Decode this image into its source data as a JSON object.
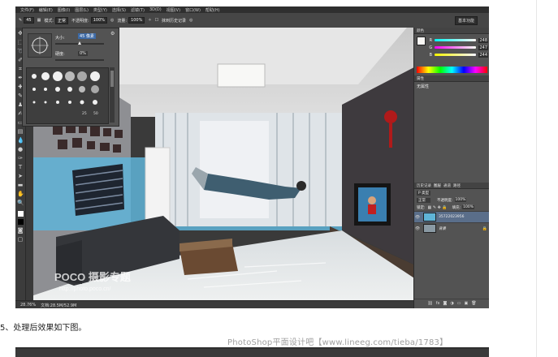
{
  "menubar": {
    "items": [
      "文件(F)",
      "编辑(E)",
      "图像(I)",
      "图层(L)",
      "类型(Y)",
      "选择(S)",
      "滤镜(T)",
      "3D(D)",
      "视图(V)",
      "窗口(W)",
      "帮助(H)"
    ]
  },
  "options_bar": {
    "brush_size": "45",
    "mode_label": "模式:",
    "mode_value": "正常",
    "opacity_label": "不透明度:",
    "opacity_value": "100%",
    "flow_label": "流量:",
    "flow_value": "100%",
    "history_label": "抹到历史记录",
    "workspace": "基本功能"
  },
  "brush_panel": {
    "size_label": "大小:",
    "size_value": "45 像素",
    "hardness_label": "硬度:",
    "hardness_value": "0%",
    "preset_numbers": [
      "25",
      "50"
    ]
  },
  "color_panel": {
    "r_label": "R",
    "r_value": "248",
    "g_label": "G",
    "g_value": "247",
    "b_label": "B",
    "b_value": "244"
  },
  "properties_panel": {
    "tab": "属性",
    "text": "无属性"
  },
  "layers_panel": {
    "tabs": [
      "历史记录",
      "图层",
      "通道",
      "路径"
    ],
    "kind_label": "P 类型",
    "blend_mode": "正常",
    "opacity_label": "不透明度:",
    "opacity_value": "100%",
    "lock_label": "锁定:",
    "fill_label": "填充:",
    "fill_value": "100%",
    "layers": [
      {
        "name": "35722023956"
      },
      {
        "name": "背景"
      }
    ]
  },
  "statusbar": {
    "zoom": "28.76%",
    "doc": "文档:28.5M/52.9M"
  },
  "canvas": {
    "watermark_logo": "POCO 摄影专题",
    "watermark_url": "http://photo.poco.cn/"
  },
  "caption": "5、处理后效果如下图。",
  "page_watermark": "PhotoShop平面设计吧【www.lineeg.com/tieba/1783】",
  "colors": {
    "ui_dark": "#3a3a3a",
    "panel": "#535353",
    "sky_blue": "#5fb4d8",
    "selected_layer": "#5a6e8a"
  }
}
